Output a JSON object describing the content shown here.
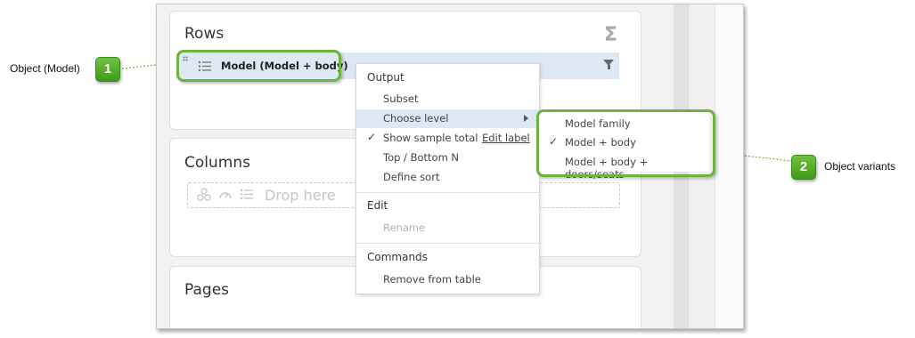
{
  "panels": {
    "rows_title": "Rows",
    "columns_title": "Columns",
    "pages_title": "Pages",
    "row_item_label": "Model (Model + body)",
    "drop_placeholder": "Drop here"
  },
  "context_menu": {
    "output_header": "Output",
    "subset": "Subset",
    "choose_level": "Choose level",
    "show_sample_total": "Show sample total",
    "edit_label": "Edit label",
    "top_bottom": "Top / Bottom N",
    "define_sort": "Define sort",
    "edit_header": "Edit",
    "rename": "Rename",
    "commands_header": "Commands",
    "remove": "Remove from table"
  },
  "submenu": {
    "items": [
      "Model family",
      "Model + body",
      "Model + body + doors/seats"
    ],
    "checked_index": 1
  },
  "callouts": [
    {
      "number": "1",
      "label": "Object (Model)"
    },
    {
      "number": "2",
      "label": "Object variants"
    }
  ],
  "colors": {
    "accent_green": "#6cb33f",
    "highlight_blue": "#dde8f4"
  },
  "icons": [
    "sigma-icon",
    "list-icon",
    "filter-icon",
    "checkmark-icon",
    "submenu-arrow-icon",
    "network-icon",
    "gauge-icon",
    "drag-handle-icon"
  ]
}
